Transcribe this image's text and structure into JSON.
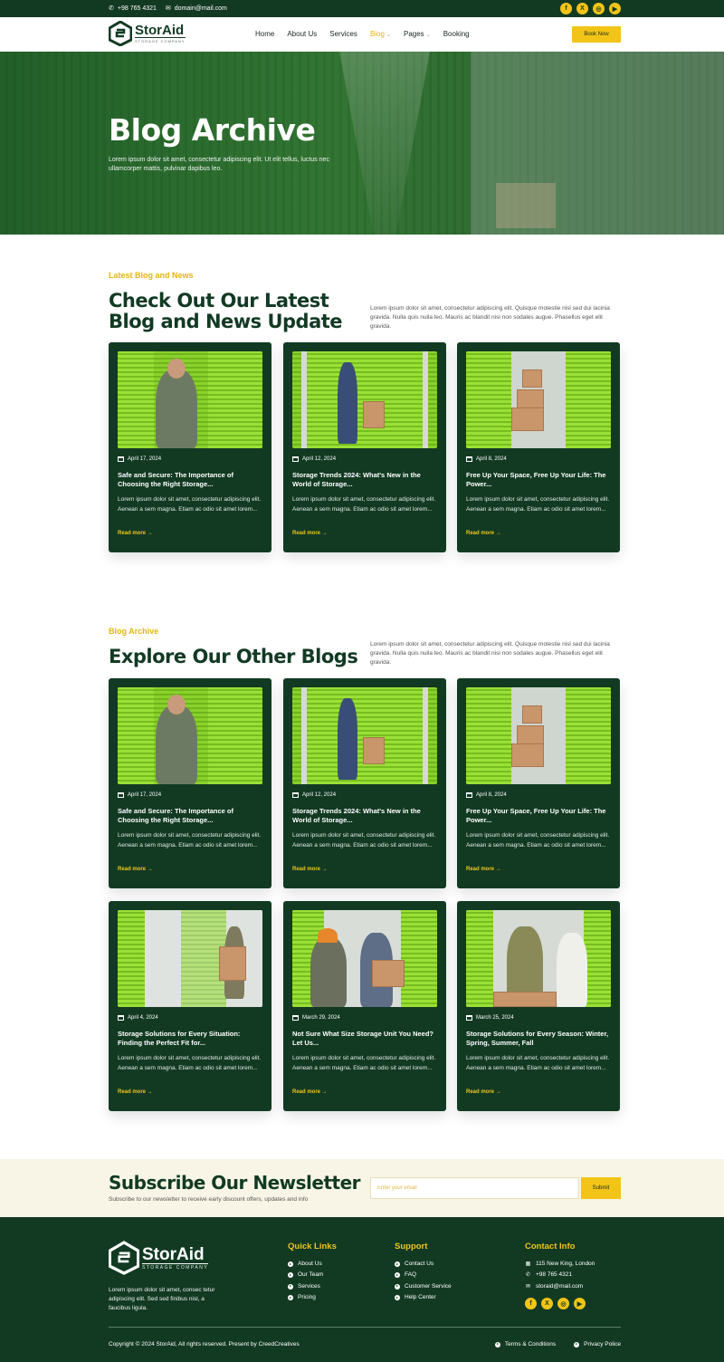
{
  "topbar": {
    "phone": "+98 765 4321",
    "email": "domain@mail.com",
    "social": [
      "f",
      "X",
      "◎",
      "▶"
    ]
  },
  "header": {
    "logo_name": "StorAid",
    "logo_tag": "STORAGE COMPANY",
    "nav": [
      {
        "label": "Home"
      },
      {
        "label": "About Us"
      },
      {
        "label": "Services"
      },
      {
        "label": "Blog"
      },
      {
        "label": "Pages"
      },
      {
        "label": "Booking"
      }
    ],
    "book_label": "Book Now"
  },
  "hero": {
    "title": "Blog Archive",
    "text": "Lorem ipsum dolor sit amet, consectetur adipiscing elit. Ut elit tellus, luctus nec ullamcorper mattis, pulvinar dapibus leo."
  },
  "latest": {
    "eyebrow": "Latest Blog and News",
    "title": "Check Out Our Latest Blog and News Update",
    "desc": "Lorem ipsum dolor sit amet, consectetur adipiscing elit. Quisque molestie nisl sed dui lacinia gravida. Nulla quis nulla leo. Mauris ac blandit nisi non sodales augue. Phasellus eget elit gravida."
  },
  "archive": {
    "eyebrow": "Blog Archive",
    "title": "Explore Our Other Blogs",
    "desc": "Lorem ipsum dolor sit amet, consectetur adipiscing elit. Quisque molestie nisl sed dui lacinia gravida. Nulla quis nulla leo. Mauris ac blandit nisi non sodales augue. Phasellus eget elit gravida."
  },
  "posts": [
    {
      "date": "April 17, 2024",
      "title": "Safe and Secure: The Importance of Choosing the Right Storage...",
      "excerpt": "Lorem ipsum dolor sit amet, consectetur adipiscing elit. Aenean a sem magna. Etiam ac odio sit amet lorem...",
      "more": "Read more →"
    },
    {
      "date": "April 12, 2024",
      "title": "Storage Trends 2024: What's New in the World of Storage...",
      "excerpt": "Lorem ipsum dolor sit amet, consectetur adipiscing elit. Aenean a sem magna. Etiam ac odio sit amet lorem...",
      "more": "Read more →"
    },
    {
      "date": "April 8, 2024",
      "title": "Free Up Your Space, Free Up Your Life: The Power...",
      "excerpt": "Lorem ipsum dolor sit amet, consectetur adipiscing elit. Aenean a sem magna. Etiam ac odio sit amet lorem...",
      "more": "Read more →"
    },
    {
      "date": "April 17, 2024",
      "title": "Safe and Secure: The Importance of Choosing the Right Storage...",
      "excerpt": "Lorem ipsum dolor sit amet, consectetur adipiscing elit. Aenean a sem magna. Etiam ac odio sit amet lorem...",
      "more": "Read more →"
    },
    {
      "date": "April 12, 2024",
      "title": "Storage Trends 2024: What's New in the World of Storage...",
      "excerpt": "Lorem ipsum dolor sit amet, consectetur adipiscing elit. Aenean a sem magna. Etiam ac odio sit amet lorem...",
      "more": "Read more →"
    },
    {
      "date": "April 8, 2024",
      "title": "Free Up Your Space, Free Up Your Life: The Power...",
      "excerpt": "Lorem ipsum dolor sit amet, consectetur adipiscing elit. Aenean a sem magna. Etiam ac odio sit amet lorem...",
      "more": "Read more →"
    },
    {
      "date": "April 4, 2024",
      "title": "Storage Solutions for Every Situation: Finding the Perfect Fit for...",
      "excerpt": "Lorem ipsum dolor sit amet, consectetur adipiscing elit. Aenean a sem magna. Etiam ac odio sit amet lorem...",
      "more": "Read more →"
    },
    {
      "date": "March 29, 2024",
      "title": "Not Sure What Size Storage Unit You Need? Let Us...",
      "excerpt": "Lorem ipsum dolor sit amet, consectetur adipiscing elit. Aenean a sem magna. Etiam ac odio sit amet lorem...",
      "more": "Read more →"
    },
    {
      "date": "March 25, 2024",
      "title": "Storage Solutions for Every Season: Winter, Spring, Summer, Fall",
      "excerpt": "Lorem ipsum dolor sit amet, consectetur adipiscing elit. Aenean a sem magna. Etiam ac odio sit amet lorem...",
      "more": "Read more →"
    }
  ],
  "newsletter": {
    "title": "Subscribe Our Newsletter",
    "sub": "Subscribe to our newsletter to receive early discount offers, updates and info",
    "placeholder": "Enter your email",
    "submit": "Submit"
  },
  "footer": {
    "logo_name": "StorAid",
    "logo_tag": "STORAGE COMPANY",
    "about": "Lorem ipsum dolor sit amet, consec tetur adipiscing elit. Sed sed finibus nisl, a faucibus ligula.",
    "quick_title": "Quick Links",
    "quick": [
      "About Us",
      "Our Team",
      "Services",
      "Pricing"
    ],
    "support_title": "Support",
    "support": [
      "Contact Us",
      "FAQ",
      "Customer Service",
      "Help Center"
    ],
    "contact_title": "Contact Info",
    "contact": [
      "115 New King, London",
      "+98 765 4321",
      "storaid@mail.com"
    ],
    "social": [
      "f",
      "X",
      "◎",
      "▶"
    ],
    "copyright": "Copyright © 2024 StorAid, All rights reserved. Present by CreedCreatives",
    "terms": "Terms & Conditions",
    "privacy": "Privacy Police"
  },
  "colors": {
    "primary": "#123a23",
    "accent": "#f2c417",
    "cream": "#f8f5e6"
  }
}
